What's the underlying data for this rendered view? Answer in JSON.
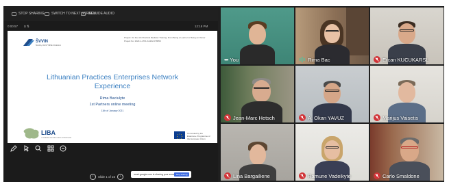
{
  "toolbar": {
    "items": [
      "STOP SHARING",
      "SWITCH TO NEXT SCREEN",
      "INCLUDE AUDIO"
    ]
  },
  "subbar": {
    "left": "0:00:57",
    "right": "12:18 PM"
  },
  "slide": {
    "logo_text": "ŠVVIN",
    "logo_sub": "ŠIAULIŲ VALSTYBINĖ KOLEGIJA",
    "project_line1": "Project:   On the Job Practical Mediator Training: From Being a Learner to Being an Owner",
    "project_line2": "Project No:   2020-1-LT01-KA202-078059",
    "title_line1": "Lithuanian Practices Enterprises Network",
    "title_line2": "Experience",
    "author": "Rima Baciulyte",
    "meeting": "1st Partners online meeting",
    "date": "11th of January 2021",
    "liba_text": "LIBA",
    "liba_sub": "LITHUANIAN INNOVATION AND BUSINESS ASSOCIATION",
    "eu_text": "Co-funded by the Erasmus+ Programme of the European Union"
  },
  "tools": [
    "pen-icon",
    "pointer-icon",
    "zoom-icon",
    "grid-icon",
    "more-icon"
  ],
  "nav": {
    "slide_counter": "Slide 1 of 15"
  },
  "share_toast": {
    "message": "meet.google.com is sharing your screen",
    "stop_label": "Stop sharing"
  },
  "participants": [
    {
      "name": "You",
      "muted": false,
      "speaking": false,
      "indicator": "more"
    },
    {
      "name": "Rima Bac",
      "muted": false,
      "speaking": true
    },
    {
      "name": "Ercan KUCUKARSL",
      "muted": true
    },
    {
      "name": "Jean-Marc Hetsch",
      "muted": true
    },
    {
      "name": "A. Okan YAVUZ",
      "muted": true
    },
    {
      "name": "Marijus Vaisetis",
      "muted": true
    },
    {
      "name": "Lina Bargailiene",
      "muted": true
    },
    {
      "name": "Ramune Vadeikyte",
      "muted": true
    },
    {
      "name": "Carlo Smaldone",
      "muted": true
    }
  ],
  "colors": {
    "slide_title": "#3a7fc1",
    "slide_text": "#1e4d8c",
    "muted_red": "#d13438",
    "screen_bg": "#1f1f1f"
  }
}
